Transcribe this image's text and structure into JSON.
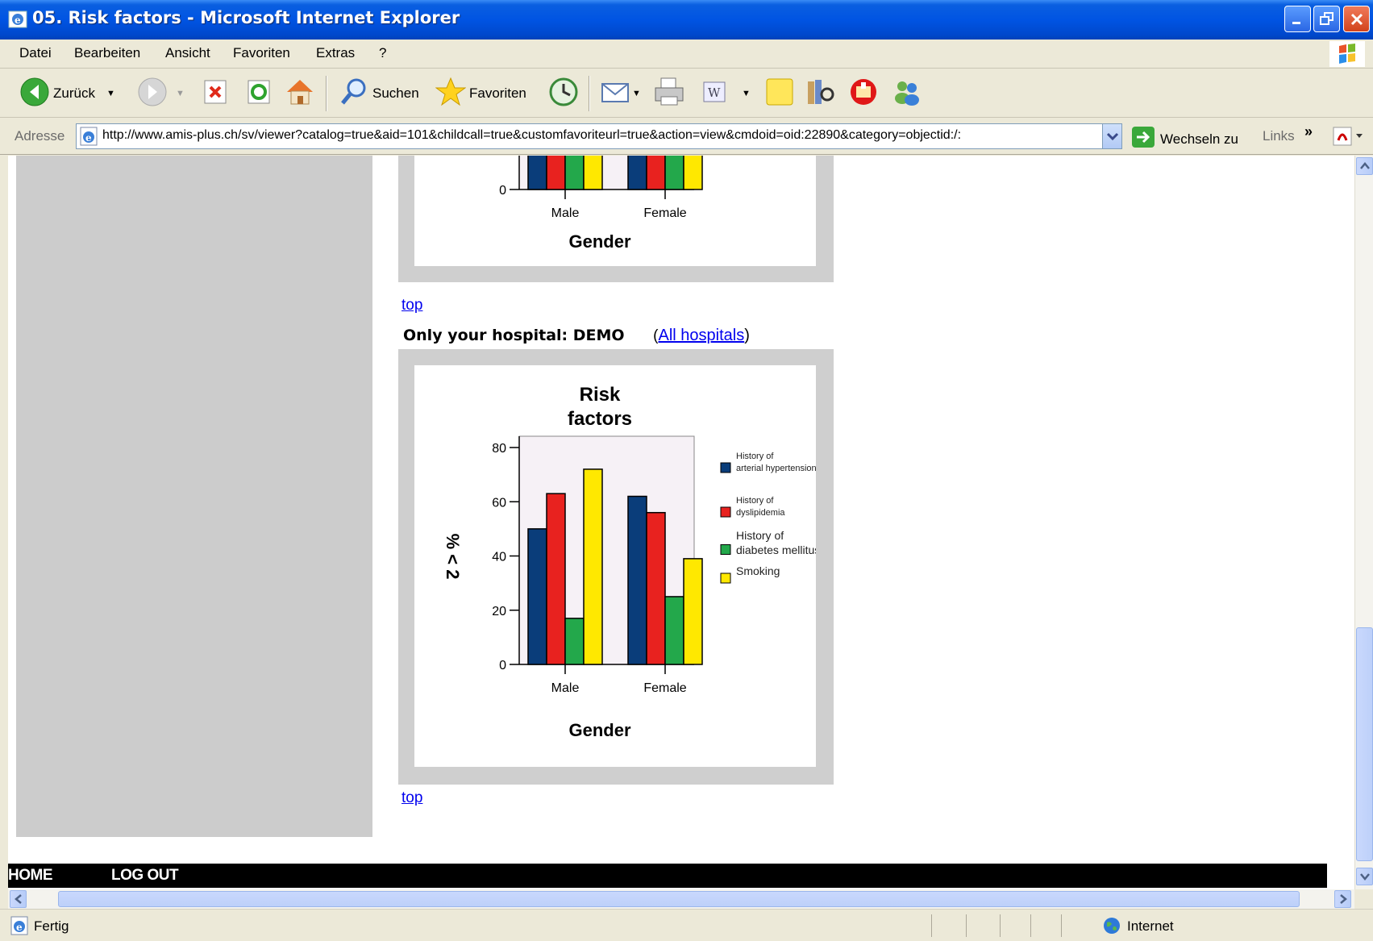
{
  "window": {
    "title": "05. Risk factors - Microsoft Internet Explorer"
  },
  "menubar": {
    "items": [
      "Datei",
      "Bearbeiten",
      "Ansicht",
      "Favoriten",
      "Extras",
      "?"
    ]
  },
  "toolbar": {
    "back_label": "Zurück",
    "search_label": "Suchen",
    "favorites_label": "Favoriten"
  },
  "addressbar": {
    "label": "Adresse",
    "url": "http://www.amis-plus.ch/sv/viewer?catalog=true&aid=101&childcall=true&customfavoriteurl=true&action=view&cmdoid=oid:22890&category=objectid:/:",
    "go_label": "Wechseln zu",
    "links_label": "Links"
  },
  "content": {
    "top_link_1": "top",
    "hospital_label": "Only your hospital: DEMO",
    "all_hospitals_open": "(",
    "all_hospitals_link": "All hospitals",
    "all_hospitals_close": ")",
    "top_link_2": "top"
  },
  "footer_nav": {
    "home": "HOME",
    "logout": "LOG OUT"
  },
  "statusbar": {
    "text": "Fertig",
    "zone": "Internet"
  },
  "colors": {
    "hypertension": "#0a3d7a",
    "dyslipidemia": "#e8221f",
    "diabetes": "#23a84b",
    "smoking": "#ffe800",
    "plot_bg": "#f6f1f6"
  },
  "chart_data": [
    {
      "type": "bar",
      "note_visible": "partial (scrolled, only bottom visible)",
      "categories": [
        "Male",
        "Female"
      ],
      "xlabel": "Gender",
      "y_ticks": [
        "0"
      ]
    },
    {
      "type": "bar",
      "title": "Risk factors",
      "categories": [
        "Male",
        "Female"
      ],
      "xlabel": "Gender",
      "ylabel": "% < 2",
      "ylim": [
        0,
        80
      ],
      "y_ticks": [
        "0",
        "20",
        "40",
        "60",
        "80"
      ],
      "legend_position": "right",
      "series": [
        {
          "name": "History of arterial hypertension",
          "values": [
            50,
            62
          ]
        },
        {
          "name": "History of dyslipidemia",
          "values": [
            63,
            56
          ]
        },
        {
          "name": "History of diabetes mellitus",
          "values": [
            17,
            25
          ]
        },
        {
          "name": "Smoking",
          "values": [
            72,
            39
          ]
        }
      ]
    }
  ]
}
